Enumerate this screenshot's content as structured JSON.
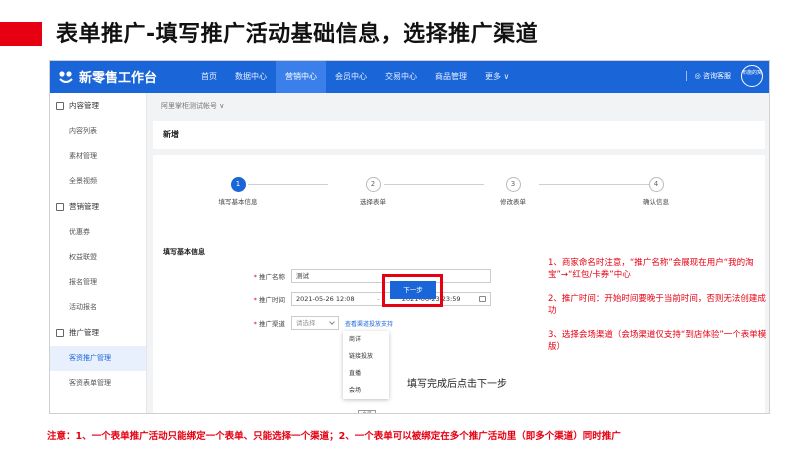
{
  "slide_title": "表单推广-填写推广活动基础信息，选择推广渠道",
  "app": {
    "logo_text": "新零售工作台",
    "nav": [
      "首页",
      "数据中心",
      "营销中心",
      "会员中心",
      "交易中心",
      "商品管理",
      "更多 ∨"
    ],
    "active_nav": "营销中心",
    "service_text": "咨询客服",
    "avatar_text": "布施的窝"
  },
  "sidebar": {
    "groups": [
      {
        "label": "内容管理",
        "icon": "document-icon",
        "items": [
          "内容列表",
          "素材管理",
          "全景视频"
        ]
      },
      {
        "label": "营销管理",
        "icon": "marketing-icon",
        "items": [
          "优惠券",
          "权益联盟",
          "报名管理",
          "活动报名"
        ]
      },
      {
        "label": "推广管理",
        "icon": "promotion-icon",
        "items": [
          "客资推广管理",
          "客资表单管理"
        ]
      }
    ],
    "active_item": "客资推广管理"
  },
  "main": {
    "account": "阿里掌柜测试帐号 ∨",
    "page_title": "新增",
    "steps": [
      {
        "num": "1",
        "label": "填写基本信息"
      },
      {
        "num": "2",
        "label": "选择表单"
      },
      {
        "num": "3",
        "label": "修改表单"
      },
      {
        "num": "4",
        "label": "确认信息"
      }
    ],
    "section_title": "填写基本信息",
    "form": {
      "name_label": "推广名称",
      "name_value": "测试",
      "time_label": "推广时间",
      "start_time": "2021-05-26 12:08",
      "time_sep": "-",
      "end_time": "2021-06-23 23:59",
      "channel_label": "推广渠道",
      "channel_placeholder": "请选择",
      "channel_link": "查看渠道投放支持",
      "required_mark": "*"
    },
    "dropdown_options": [
      "商详",
      "链接投放",
      "直播",
      "会场"
    ],
    "tooltip": "会场",
    "next_button": "下一步"
  },
  "annotations": {
    "next_note": "填写完成后点击下一步",
    "notes": [
      "1、商家命名时注意，“推广名称”会展现在用户“我的淘宝”→“红包/卡券”中心",
      "2、推广时间：开始时间要晚于当前时间，否则无法创建成功",
      "3、选择会场渠道（会场渠道仅支持“到店体验”一个表单模版）"
    ],
    "footer": "注意：1、一个表单推广活动只能绑定一个表单、只能选择一个渠道；2、一个表单可以被绑定在多个推广活动里（即多个渠道）同时推广"
  },
  "colors": {
    "brand_blue": "#1a66d8",
    "accent_red": "#e60012"
  }
}
